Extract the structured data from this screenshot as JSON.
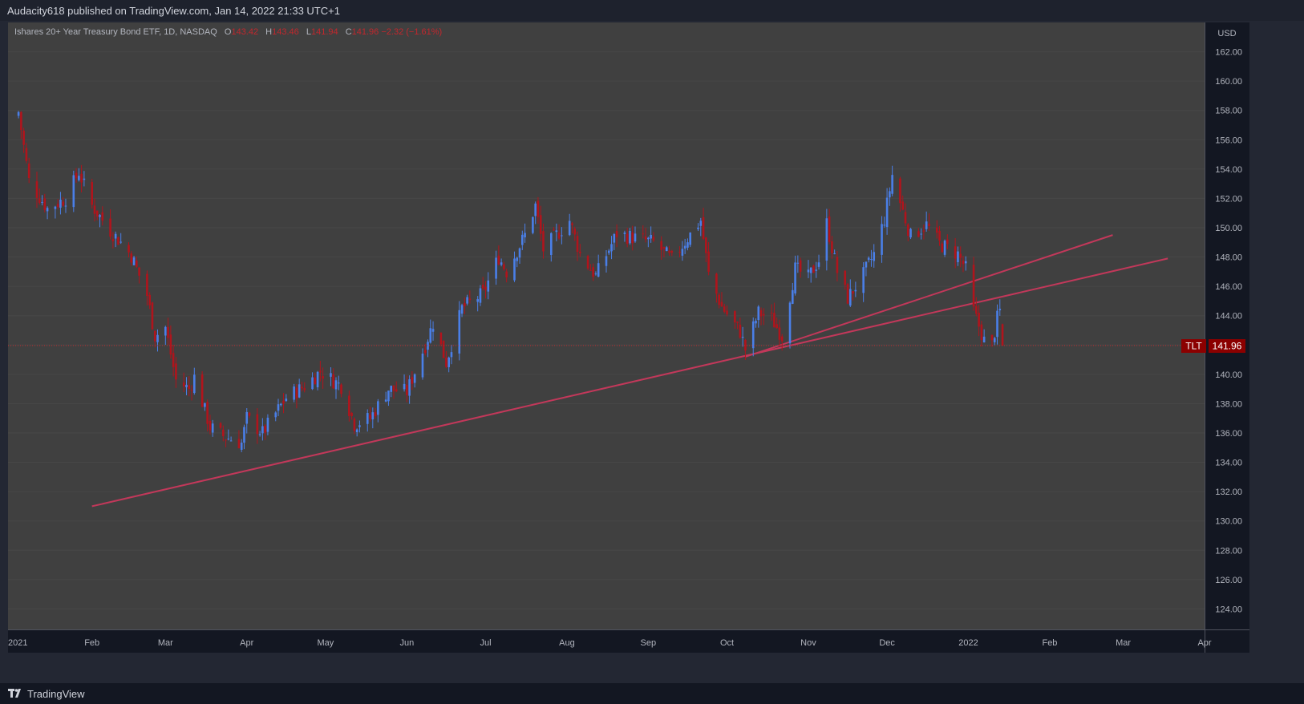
{
  "header": {
    "published_text": "Audacity618 published on TradingView.com, Jan 14, 2022 21:33 UTC+1"
  },
  "footer": {
    "brand": "TradingView",
    "brand_icon": "tradingview-logo-icon"
  },
  "legend": {
    "symbol_name": "Ishares 20+ Year Treasury Bond ETF, 1D, NASDAQ",
    "open_key": "O",
    "open": "143.42",
    "high_key": "H",
    "high": "143.46",
    "low_key": "L",
    "low": "141.94",
    "close_key": "C",
    "close": "141.96",
    "change": "−2.32 (−1.61%)"
  },
  "colors": {
    "background": "#404040",
    "up_candle": "#4a7fe8",
    "down_candle": "#b0141c",
    "trendline": "#c2385a",
    "price_line": "#c2272d",
    "axis_bg": "#131722",
    "axis_text": "#b2b5be"
  },
  "chart_data": {
    "type": "candlestick",
    "symbol": "TLT",
    "currency": "USD",
    "last_price": 141.96,
    "last_price_label": "141.96",
    "ticker_label": "TLT",
    "ylim": [
      122.6,
      164.0
    ],
    "y_ticks": [
      124,
      126,
      128,
      130,
      132,
      134,
      136,
      138,
      140,
      142,
      144,
      146,
      148,
      150,
      152,
      154,
      156,
      158,
      160,
      162
    ],
    "y_tick_labels": [
      "124.00",
      "126.00",
      "128.00",
      "130.00",
      "132.00",
      "134.00",
      "136.00",
      "138.00",
      "140.00",
      "142.00",
      "144.00",
      "146.00",
      "148.00",
      "150.00",
      "152.00",
      "154.00",
      "156.00",
      "158.00",
      "160.00",
      "162.00"
    ],
    "x_range": [
      "2020-12-31",
      "2022-04-01"
    ],
    "x_ticks": [
      {
        "date": "2021-01-01",
        "label": "2021"
      },
      {
        "date": "2021-02-01",
        "label": "Feb"
      },
      {
        "date": "2021-03-01",
        "label": "Mar"
      },
      {
        "date": "2021-04-01",
        "label": "Apr"
      },
      {
        "date": "2021-05-01",
        "label": "May"
      },
      {
        "date": "2021-06-01",
        "label": "Jun"
      },
      {
        "date": "2021-07-01",
        "label": "Jul"
      },
      {
        "date": "2021-08-01",
        "label": "Aug"
      },
      {
        "date": "2021-09-01",
        "label": "Sep"
      },
      {
        "date": "2021-10-01",
        "label": "Oct"
      },
      {
        "date": "2021-11-01",
        "label": "Nov"
      },
      {
        "date": "2021-12-01",
        "label": "Dec"
      },
      {
        "date": "2022-01-01",
        "label": "2022"
      },
      {
        "date": "2022-02-01",
        "label": "Feb"
      },
      {
        "date": "2022-03-01",
        "label": "Mar"
      },
      {
        "date": "2022-04-01",
        "label": "Apr"
      }
    ],
    "close_anchors": [
      [
        "2021-01-04",
        157.9
      ],
      [
        "2021-01-08",
        153.2
      ],
      [
        "2021-01-15",
        151.3
      ],
      [
        "2021-01-22",
        152.0
      ],
      [
        "2021-01-27",
        153.8
      ],
      [
        "2021-02-01",
        151.5
      ],
      [
        "2021-02-08",
        149.8
      ],
      [
        "2021-02-12",
        149.0
      ],
      [
        "2021-02-16",
        148.1
      ],
      [
        "2021-02-22",
        145.4
      ],
      [
        "2021-02-25",
        142.6
      ],
      [
        "2021-03-01",
        143.2
      ],
      [
        "2021-03-05",
        139.6
      ],
      [
        "2021-03-10",
        139.0
      ],
      [
        "2021-03-12",
        139.8
      ],
      [
        "2021-03-18",
        136.4
      ],
      [
        "2021-03-23",
        135.8
      ],
      [
        "2021-03-30",
        135.3
      ],
      [
        "2021-04-01",
        137.0
      ],
      [
        "2021-04-07",
        136.0
      ],
      [
        "2021-04-16",
        138.4
      ],
      [
        "2021-04-23",
        139.2
      ],
      [
        "2021-04-29",
        140.2
      ],
      [
        "2021-05-07",
        139.2
      ],
      [
        "2021-05-12",
        136.6
      ],
      [
        "2021-05-18",
        137.0
      ],
      [
        "2021-05-25",
        139.0
      ],
      [
        "2021-06-01",
        138.8
      ],
      [
        "2021-06-08",
        142.0
      ],
      [
        "2021-06-11",
        143.5
      ],
      [
        "2021-06-16",
        140.8
      ],
      [
        "2021-06-22",
        144.5
      ],
      [
        "2021-06-30",
        145.5
      ],
      [
        "2021-07-06",
        148.0
      ],
      [
        "2021-07-09",
        147.0
      ],
      [
        "2021-07-16",
        149.5
      ],
      [
        "2021-07-20",
        151.5
      ],
      [
        "2021-07-23",
        148.5
      ],
      [
        "2021-08-02",
        150.5
      ],
      [
        "2021-08-06",
        148.2
      ],
      [
        "2021-08-12",
        146.7
      ],
      [
        "2021-08-20",
        149.6
      ],
      [
        "2021-08-27",
        149.3
      ],
      [
        "2021-09-03",
        149.0
      ],
      [
        "2021-09-10",
        147.8
      ],
      [
        "2021-09-16",
        149.3
      ],
      [
        "2021-09-21",
        150.5
      ],
      [
        "2021-09-24",
        146.8
      ],
      [
        "2021-09-29",
        144.6
      ],
      [
        "2021-10-06",
        142.9
      ],
      [
        "2021-10-08",
        141.7
      ],
      [
        "2021-10-13",
        144.2
      ],
      [
        "2021-10-18",
        143.8
      ],
      [
        "2021-10-22",
        142.6
      ],
      [
        "2021-10-27",
        147.2
      ],
      [
        "2021-11-01",
        146.6
      ],
      [
        "2021-11-05",
        147.8
      ],
      [
        "2021-11-08",
        150.3
      ],
      [
        "2021-11-12",
        147.0
      ],
      [
        "2021-11-16",
        145.2
      ],
      [
        "2021-11-22",
        146.8
      ],
      [
        "2021-11-26",
        148.2
      ],
      [
        "2021-11-30",
        150.6
      ],
      [
        "2021-12-03",
        153.6
      ],
      [
        "2021-12-06",
        151.7
      ],
      [
        "2021-12-10",
        149.4
      ],
      [
        "2021-12-16",
        150.2
      ],
      [
        "2021-12-21",
        148.9
      ],
      [
        "2021-12-28",
        148.2
      ],
      [
        "2021-12-31",
        147.2
      ],
      [
        "2022-01-03",
        144.3
      ],
      [
        "2022-01-07",
        142.3
      ],
      [
        "2022-01-10",
        142.0
      ],
      [
        "2022-01-12",
        143.8
      ],
      [
        "2022-01-13",
        144.3
      ],
      [
        "2022-01-14",
        141.96
      ]
    ],
    "last_candle": {
      "date": "2022-01-14",
      "open": 143.42,
      "high": 143.46,
      "low": 141.94,
      "close": 141.96
    },
    "trendlines": [
      {
        "name": "support-line-1",
        "start": [
          "2021-02-01",
          131.0
        ],
        "end": [
          "2022-03-18",
          147.9
        ]
      },
      {
        "name": "support-line-2",
        "start": [
          "2021-10-08",
          141.2
        ],
        "end": [
          "2022-02-25",
          149.5
        ]
      }
    ]
  }
}
